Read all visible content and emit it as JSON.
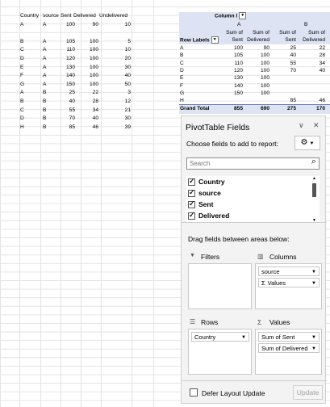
{
  "source_table": {
    "headers": [
      "Country",
      "source",
      "Sent",
      "Delivered",
      "Undelivered"
    ],
    "rows": [
      [
        "A",
        "A",
        "100",
        "90",
        "10"
      ],
      [
        "",
        "",
        "",
        "",
        ""
      ],
      [
        "B",
        "A",
        "105",
        "100",
        "5"
      ],
      [
        "C",
        "A",
        "110",
        "100",
        "10"
      ],
      [
        "D",
        "A",
        "120",
        "100",
        "20"
      ],
      [
        "E",
        "A",
        "130",
        "100",
        "30"
      ],
      [
        "F",
        "A",
        "140",
        "100",
        "40"
      ],
      [
        "G",
        "A",
        "150",
        "100",
        "50"
      ],
      [
        "A",
        "B",
        "25",
        "22",
        "3"
      ],
      [
        "B",
        "B",
        "40",
        "28",
        "12"
      ],
      [
        "C",
        "B",
        "55",
        "34",
        "21"
      ],
      [
        "D",
        "B",
        "70",
        "40",
        "30"
      ],
      [
        "H",
        "B",
        "85",
        "46",
        "39"
      ]
    ]
  },
  "pivot": {
    "col_labels": "Column l",
    "col_A": "A",
    "col_B": "B",
    "row_labels": "Row Labels",
    "hdr_sum_sent": "Sum of Sent",
    "hdr_sum_delivered": "Sum of Delivered",
    "rows": [
      [
        "A",
        "100",
        "90",
        "25",
        "22"
      ],
      [
        "B",
        "105",
        "100",
        "40",
        "28"
      ],
      [
        "C",
        "110",
        "100",
        "55",
        "34"
      ],
      [
        "D",
        "120",
        "100",
        "70",
        "40"
      ],
      [
        "E",
        "130",
        "100",
        "",
        ""
      ],
      [
        "F",
        "140",
        "100",
        "",
        ""
      ],
      [
        "G",
        "150",
        "100",
        "",
        ""
      ],
      [
        "H",
        "",
        "",
        "85",
        "46"
      ]
    ],
    "grand_total": [
      "Grand Total",
      "855",
      "690",
      "275",
      "170"
    ]
  },
  "pane": {
    "title": "PivotTable Fields",
    "subtitle": "Choose fields to add to report:",
    "search_placeholder": "Search",
    "fields": [
      "Country",
      "source",
      "Sent",
      "Delivered"
    ],
    "drag_label": "Drag fields between areas below:",
    "filters_label": "Filters",
    "columns_label": "Columns",
    "rows_label": "Rows",
    "values_label": "Values",
    "columns_items": [
      "source",
      "Values"
    ],
    "rows_items": [
      "Country"
    ],
    "values_items": [
      "Sum of Sent",
      "Sum of Delivered"
    ],
    "defer_label": "Defer Layout Update",
    "update_label": "Update",
    "collapse_glyph": "∨",
    "close_glyph": "✕",
    "gear_glyph": "⚙",
    "search_glyph": "⌕",
    "sigma_glyph": "Σ",
    "dropdown_glyph": "▼"
  }
}
